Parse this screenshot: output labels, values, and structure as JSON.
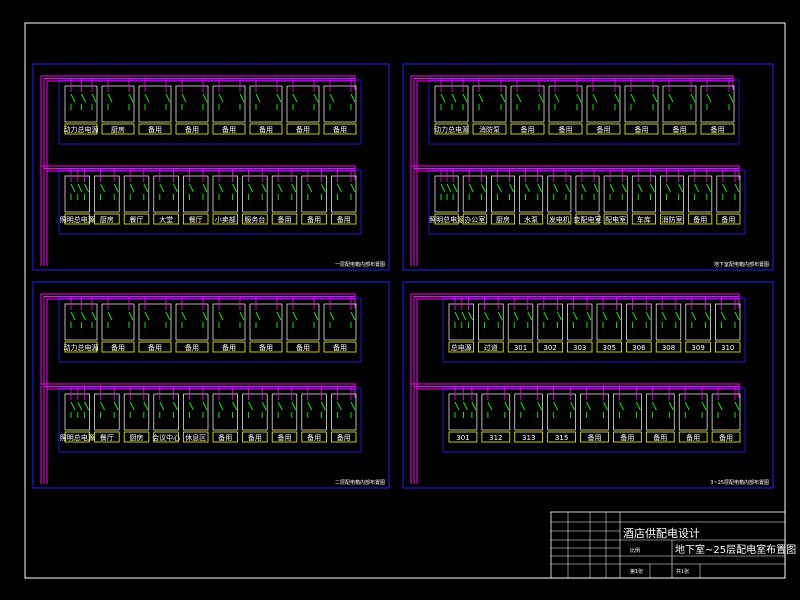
{
  "colors": {
    "background": "#000000",
    "frame": "#ffffff",
    "panel_border": "#2020ff",
    "breaker_cell": "#ffffff",
    "breaker_symbol": "#00ff00",
    "label_box": "#ffff00",
    "bus_wire": "#ff00ff",
    "label_text": "#ffffff"
  },
  "panels": [
    {
      "title": "一层配电箱内部布置图",
      "rows": [
        {
          "labels": [
            "动力总电源",
            "厨房",
            "备用",
            "备用",
            "备用",
            "备用",
            "备用",
            "备用"
          ]
        },
        {
          "labels": [
            "照明总电源",
            "厨房",
            "餐厅",
            "大堂",
            "餐厅",
            "小卖部",
            "服务台",
            "备用",
            "备用",
            "备用"
          ]
        }
      ]
    },
    {
      "title": "地下室配电箱内部布置图",
      "rows": [
        {
          "labels": [
            "动力总电源",
            "消防泵",
            "备用",
            "备用",
            "备用",
            "备用",
            "备用",
            "备用"
          ]
        },
        {
          "labels": [
            "照明总电源",
            "办公室",
            "厨房",
            "水泵",
            "发电机",
            "变配电室",
            "配电室",
            "车库",
            "消防室",
            "备用",
            "备用"
          ]
        }
      ]
    },
    {
      "title": "二层配电箱内部布置图",
      "rows": [
        {
          "labels": [
            "动力总电源",
            "备用",
            "备用",
            "备用",
            "备用",
            "备用",
            "备用",
            "备用"
          ]
        },
        {
          "labels": [
            "照明总电源",
            "餐厅",
            "厨房",
            "会议中心",
            "休息区",
            "备用",
            "备用",
            "备用",
            "备用",
            "备用"
          ]
        }
      ]
    },
    {
      "title": "3~25层配电箱内部布置图",
      "rows": [
        {
          "labels": [
            "总电源",
            "过道",
            "301",
            "302",
            "303",
            "305",
            "306",
            "308",
            "309",
            "310"
          ]
        },
        {
          "labels": [
            "301",
            "312",
            "313",
            "315",
            "备用",
            "备用",
            "备用",
            "备用",
            "备用"
          ]
        }
      ]
    }
  ],
  "title_block": {
    "project": "酒店供配电设计",
    "drawing_name": "地下室~25层配电室布置图",
    "scale_label": "比例",
    "sheet_label": "第1张",
    "total_label": "共1张"
  }
}
